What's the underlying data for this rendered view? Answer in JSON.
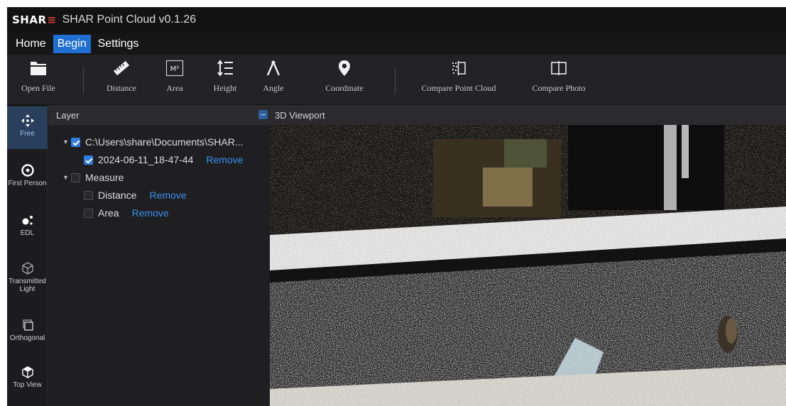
{
  "app": {
    "logo_main": "SHAR",
    "logo_accent": "≡",
    "title": "SHAR Point Cloud v0.1.26"
  },
  "menu": [
    {
      "label": "Home",
      "active": false
    },
    {
      "label": "Begin",
      "active": true
    },
    {
      "label": "Settings",
      "active": false
    }
  ],
  "toolbar": {
    "open_file": {
      "label": "Open File",
      "icon": "folder-icon"
    },
    "distance": {
      "label": "Distance",
      "icon": "ruler-icon"
    },
    "area": {
      "label": "Area",
      "icon": "area-m2-icon",
      "icon_text": "M²"
    },
    "height": {
      "label": "Height",
      "icon": "height-icon"
    },
    "angle": {
      "label": "Angle",
      "icon": "compass-angle-icon"
    },
    "coordinate": {
      "label": "Coordinate",
      "icon": "location-pin-icon"
    },
    "compare_point_cloud": {
      "label": "Compare Point Cloud",
      "icon": "compare-point-cloud-icon"
    },
    "compare_photo": {
      "label": "Compare Photo",
      "icon": "compare-photo-icon"
    }
  },
  "modes": [
    {
      "label": "Free",
      "icon": "move-arrows-icon",
      "active": true
    },
    {
      "label": "First Person",
      "icon": "eye-icon",
      "active": false
    },
    {
      "label": "EDL",
      "icon": "dots-icon",
      "active": false
    },
    {
      "label": "Transmitted Light",
      "icon": "cube-outline-icon",
      "active": false
    },
    {
      "label": "Orthogonal",
      "icon": "orthogonal-icon",
      "active": false
    },
    {
      "label": "Top View",
      "icon": "cube-top-icon",
      "active": false
    }
  ],
  "layer_panel": {
    "title": "Layer",
    "root_path": "C:\\Users\\share\\Documents\\SHAR...",
    "scan_name": "2024-06-11_18-47-44",
    "remove_label": "Remove",
    "measure_label": "Measure",
    "distance_label": "Distance",
    "area_label": "Area"
  },
  "viewport": {
    "title": "3D Viewport"
  },
  "colors": {
    "accent_blue": "#1e6fd2",
    "link_blue": "#3b8ff0",
    "logo_red": "#e0413a",
    "panel_bg": "#1f1f21"
  }
}
